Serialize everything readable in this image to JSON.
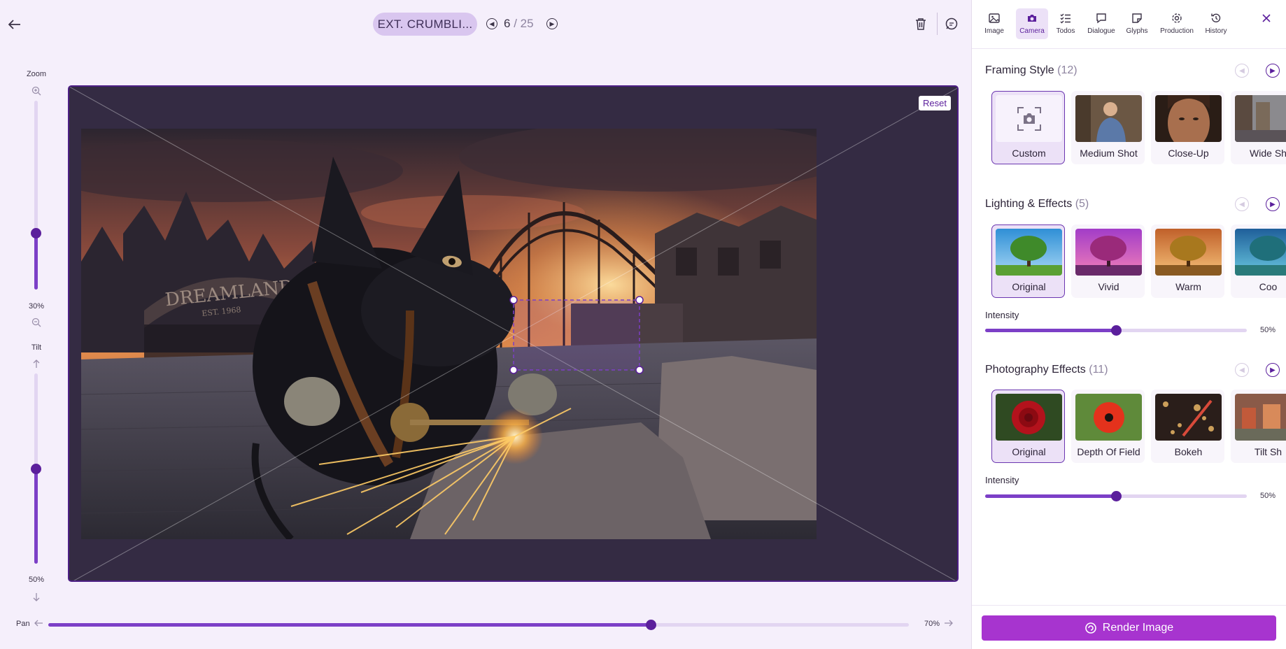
{
  "header": {
    "scene_title": "EXT. CRUMBLI...",
    "current_page": "6",
    "separator": "/",
    "total_pages": "25"
  },
  "sliders": {
    "zoom": {
      "label": "Zoom",
      "value_text": "30%",
      "value": 0.3
    },
    "tilt": {
      "label": "Tilt",
      "value_text": "50%",
      "value": 0.5
    },
    "pan": {
      "label": "Pan",
      "value_text": "70%",
      "value": 0.7
    }
  },
  "stage": {
    "reset_label": "Reset",
    "image_alt": "Black rat welding with sparks in front of an abandoned theme park"
  },
  "photo_text": {
    "arch_sign": "DREAMLAND",
    "arch_sub": "EST. 1968"
  },
  "panel": {
    "tabs": [
      {
        "label": "Image",
        "icon": "image-icon",
        "active": false
      },
      {
        "label": "Camera",
        "icon": "camera-icon",
        "active": true
      },
      {
        "label": "Todos",
        "icon": "checklist-icon",
        "active": false
      },
      {
        "label": "Dialogue",
        "icon": "chat-icon",
        "active": false
      },
      {
        "label": "Glyphs",
        "icon": "sticker-icon",
        "active": false
      },
      {
        "label": "Production",
        "icon": "gear-icon",
        "active": false
      },
      {
        "label": "History",
        "icon": "history-icon",
        "active": false
      }
    ],
    "framing": {
      "title": "Framing Style",
      "count": "(12)",
      "cards": [
        "Custom",
        "Medium Shot",
        "Close-Up",
        "Wide Sh"
      ]
    },
    "lighting": {
      "title": "Lighting & Effects",
      "count": "(5)",
      "cards": [
        "Original",
        "Vivid",
        "Warm",
        "Coo"
      ],
      "intensity_label": "Intensity",
      "intensity_text": "50%",
      "intensity": 0.5
    },
    "photography": {
      "title": "Photography Effects",
      "count": "(11)",
      "cards": [
        "Original",
        "Depth Of Field",
        "Bokeh",
        "Tilt Sh"
      ],
      "intensity_label": "Intensity",
      "intensity_text": "50%",
      "intensity": 0.5
    },
    "render_label": "Render Image"
  },
  "colors": {
    "accent": "#5b1f9c",
    "accent_fill": "#7c3fc7",
    "render_button": "#a734cf",
    "stage_bg": "#342b43"
  }
}
